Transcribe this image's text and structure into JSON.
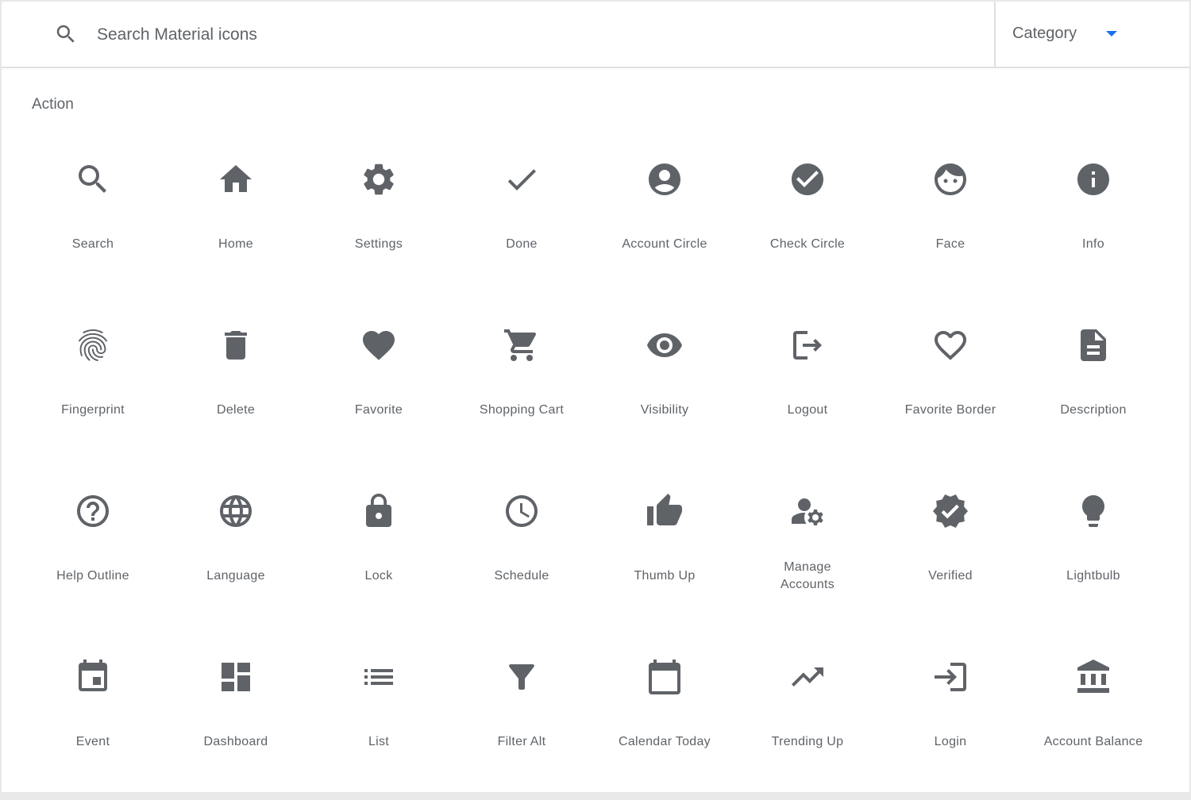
{
  "search": {
    "placeholder": "Search Material icons",
    "icon": "search-icon"
  },
  "category": {
    "label": "Category",
    "icon": "arrow-drop-down-icon",
    "accent_color": "#1a73e8"
  },
  "section": {
    "title": "Action"
  },
  "icons": [
    {
      "label": "Search",
      "icon": "search-icon"
    },
    {
      "label": "Home",
      "icon": "home-icon"
    },
    {
      "label": "Settings",
      "icon": "settings-icon"
    },
    {
      "label": "Done",
      "icon": "done-icon"
    },
    {
      "label": "Account Circle",
      "icon": "account-circle-icon"
    },
    {
      "label": "Check Circle",
      "icon": "check-circle-icon"
    },
    {
      "label": "Face",
      "icon": "face-icon"
    },
    {
      "label": "Info",
      "icon": "info-icon"
    },
    {
      "label": "Fingerprint",
      "icon": "fingerprint-icon"
    },
    {
      "label": "Delete",
      "icon": "delete-icon"
    },
    {
      "label": "Favorite",
      "icon": "favorite-icon"
    },
    {
      "label": "Shopping Cart",
      "icon": "shopping-cart-icon"
    },
    {
      "label": "Visibility",
      "icon": "visibility-icon"
    },
    {
      "label": "Logout",
      "icon": "logout-icon"
    },
    {
      "label": "Favorite Border",
      "icon": "favorite-border-icon"
    },
    {
      "label": "Description",
      "icon": "description-icon"
    },
    {
      "label": "Help Outline",
      "icon": "help-outline-icon"
    },
    {
      "label": "Language",
      "icon": "language-icon"
    },
    {
      "label": "Lock",
      "icon": "lock-icon"
    },
    {
      "label": "Schedule",
      "icon": "schedule-icon"
    },
    {
      "label": "Thumb Up",
      "icon": "thumb-up-icon"
    },
    {
      "label": "Manage Accounts",
      "icon": "manage-accounts-icon"
    },
    {
      "label": "Verified",
      "icon": "verified-icon"
    },
    {
      "label": "Lightbulb",
      "icon": "lightbulb-icon"
    },
    {
      "label": "Event",
      "icon": "event-icon"
    },
    {
      "label": "Dashboard",
      "icon": "dashboard-icon"
    },
    {
      "label": "List",
      "icon": "list-icon"
    },
    {
      "label": "Filter Alt",
      "icon": "filter-alt-icon"
    },
    {
      "label": "Calendar Today",
      "icon": "calendar-today-icon"
    },
    {
      "label": "Trending Up",
      "icon": "trending-up-icon"
    },
    {
      "label": "Login",
      "icon": "login-icon"
    },
    {
      "label": "Account Balance",
      "icon": "account-balance-icon"
    }
  ],
  "colors": {
    "icon": "#5f6368",
    "text": "#5f6368",
    "divider": "#e0e0e0"
  }
}
